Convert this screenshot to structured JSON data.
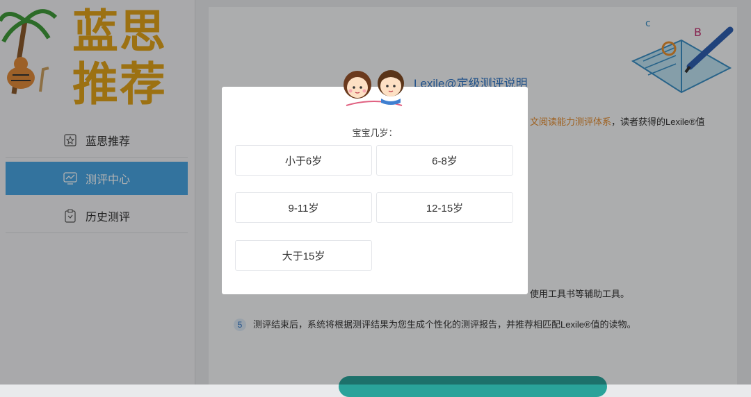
{
  "logo": {
    "line1": "蓝思",
    "line2": "推荐"
  },
  "sidebar": {
    "items": [
      {
        "label": "蓝思推荐",
        "icon": "star-icon"
      },
      {
        "label": "测评中心",
        "icon": "chart-monitor-icon",
        "active": true
      },
      {
        "label": "历史测评",
        "icon": "clipboard-icon"
      }
    ]
  },
  "main": {
    "title": "Lexile@定级测评说明",
    "intro_visible": "文阅读能力测评体系",
    "intro_tail": "，读者获得的Lexile®值",
    "step4_visible": "使用工具书等辅助工具。",
    "step5_num": "5",
    "step5_text": "测评结束后，系统将根据测评结果为您生成个性化的测评报告，并推荐相匹配Lexile®值的读物。"
  },
  "modal": {
    "question": "宝宝几岁：",
    "options": [
      "小于6岁",
      "6-8岁",
      "9-11岁",
      "12-15岁",
      "大于15岁"
    ]
  },
  "colors": {
    "accent": "#4aa5e2",
    "link": "#2f74c4",
    "logo": "#e0a21a",
    "start_button": "#2aa39a"
  }
}
